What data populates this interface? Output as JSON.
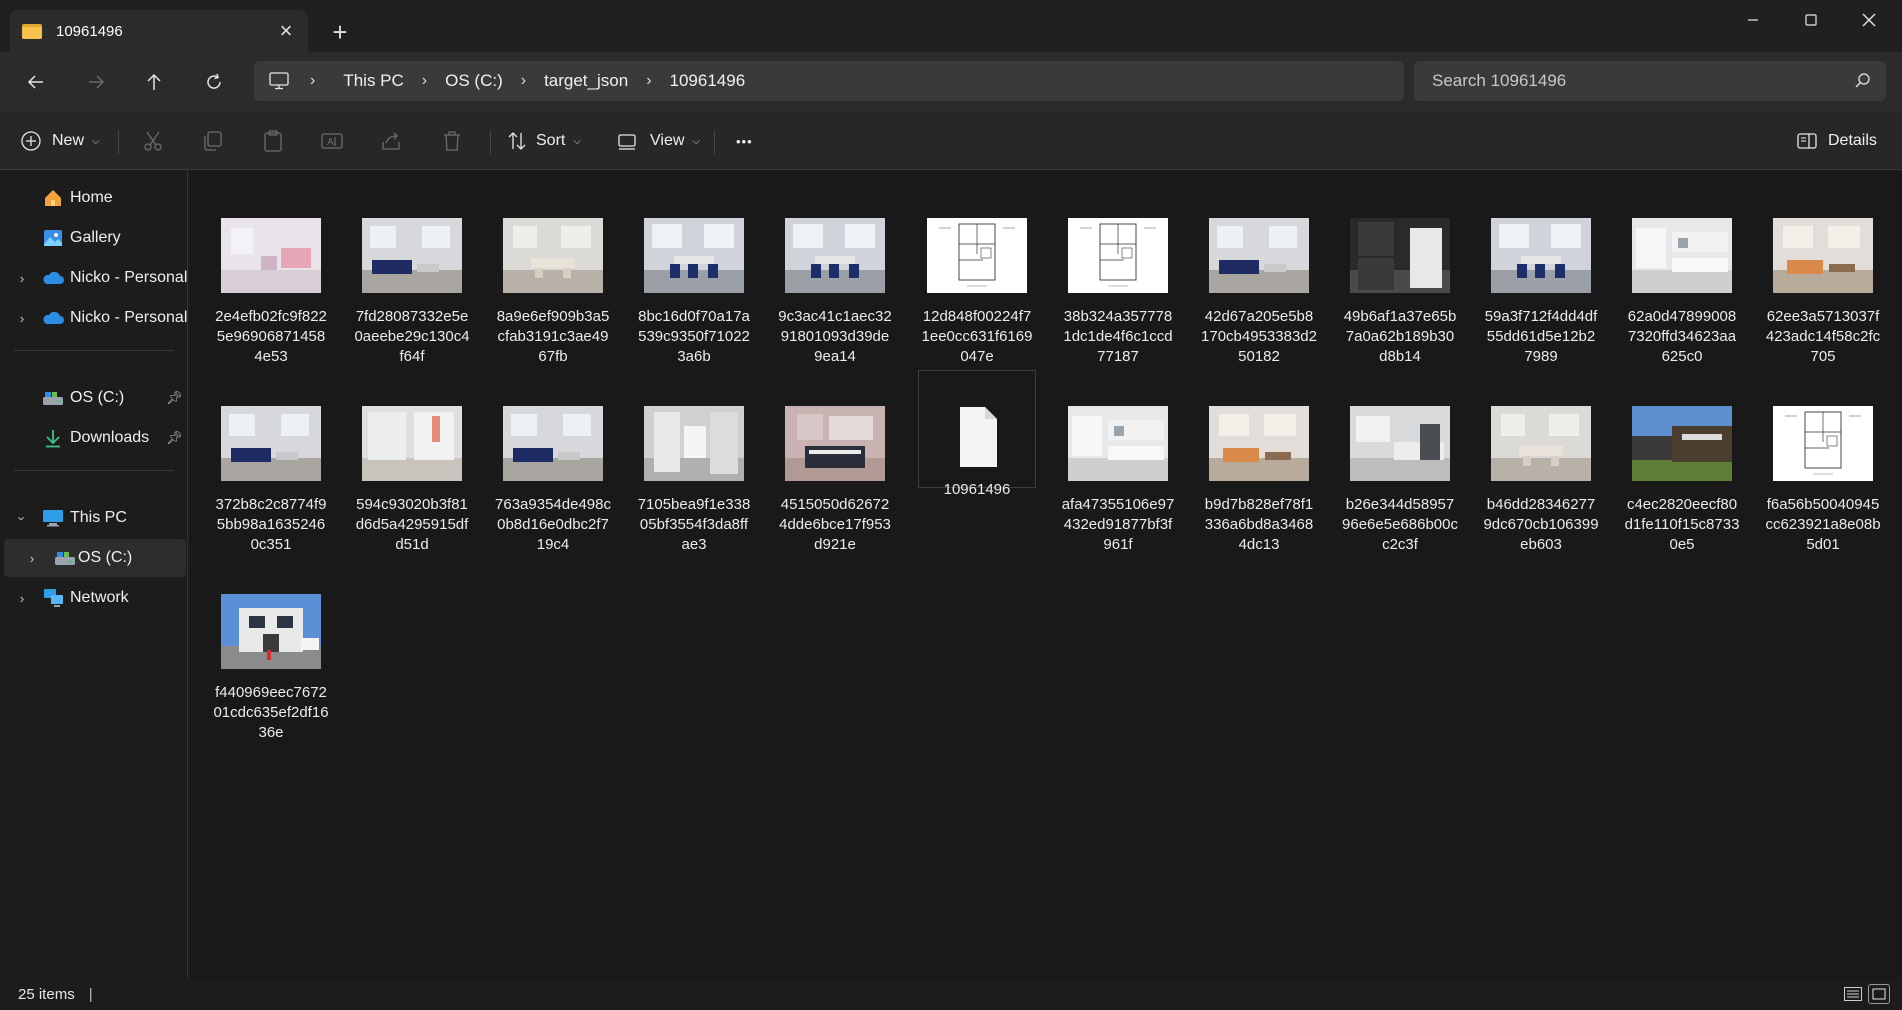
{
  "window": {
    "tab_title": "10961496",
    "new_tab_label": "+",
    "close_tab_label": "×"
  },
  "address": {
    "breadcrumbs": [
      "This PC",
      "OS (C:)",
      "target_json",
      "10961496"
    ]
  },
  "search": {
    "placeholder": "Search 10961496"
  },
  "toolbar": {
    "new_label": "New",
    "sort_label": "Sort",
    "view_label": "View",
    "more_label": "•••",
    "details_label": "Details"
  },
  "sidebar": {
    "home": "Home",
    "gallery": "Gallery",
    "onedrive_1": "Nicko - Personal",
    "onedrive_2": "Nicko - Personal",
    "os_c_pinned": "OS (C:)",
    "downloads": "Downloads",
    "this_pc": "This PC",
    "os_c": "OS (C:)",
    "network": "Network"
  },
  "files": [
    {
      "name": "2e4efb02fc9f8225e969068714584e53",
      "kind": "pink-room"
    },
    {
      "name": "7fd28087332e5e0aeebe29c130c4f64f",
      "kind": "living"
    },
    {
      "name": "8a9e6ef909b3a5cfab3191c3ae4967fb",
      "kind": "dining-light"
    },
    {
      "name": "8bc16d0f70a17a539c9350f710223a6b",
      "kind": "dining-blue"
    },
    {
      "name": "9c3ac41c1aec3291801093d39de9ea14",
      "kind": "dining-blue"
    },
    {
      "name": "12d848f00224f71ee0cc631f6169047e",
      "kind": "plan"
    },
    {
      "name": "38b324a3577781dc1de4f6c1ccd77187",
      "kind": "plan"
    },
    {
      "name": "42d67a205e5b8170cb4953383d250182",
      "kind": "living"
    },
    {
      "name": "49b6af1a37e65b7a0a62b189b30d8b14",
      "kind": "laundry"
    },
    {
      "name": "59a3f712f4dd4df55dd61d5e12b27989",
      "kind": "dining-blue"
    },
    {
      "name": "62a0d478990087320ffd34623aa625c0",
      "kind": "kitchen"
    },
    {
      "name": "62ee3a5713037f423adc14f58c2fc705",
      "kind": "living-warm"
    },
    {
      "name": "372b8c2c8774f95bb98a16352460c351",
      "kind": "living"
    },
    {
      "name": "594c93020b3f81d6d5a4295915dfd51d",
      "kind": "white-room"
    },
    {
      "name": "763a9354de498c0b8d16e0dbc2f719c4",
      "kind": "living"
    },
    {
      "name": "7105bea9f1e33805bf3554f3da8ffae3",
      "kind": "bath"
    },
    {
      "name": "4515050d626724dde6bce17f953d921e",
      "kind": "bedroom"
    },
    {
      "name": "10961496",
      "kind": "doc"
    },
    {
      "name": "afa47355106e97432ed91877bf3f961f",
      "kind": "kitchen"
    },
    {
      "name": "b9d7b828ef78f1336a6bd8a34684dc13",
      "kind": "living-warm"
    },
    {
      "name": "b26e344d5895796e6e5e686b00cc2c3f",
      "kind": "kitchen-dark"
    },
    {
      "name": "b46dd283462779dc670cb106399eb603",
      "kind": "dining-light"
    },
    {
      "name": "c4ec2820eecf80d1fe110f15c87330e5",
      "kind": "exterior-back"
    },
    {
      "name": "f6a56b50040945cc623921a8e08b5d01",
      "kind": "plan"
    },
    {
      "name": "f440969eec767201cdc635ef2df1636e",
      "kind": "exterior-front"
    }
  ],
  "status": {
    "item_count": "25 items",
    "separator": "|"
  }
}
